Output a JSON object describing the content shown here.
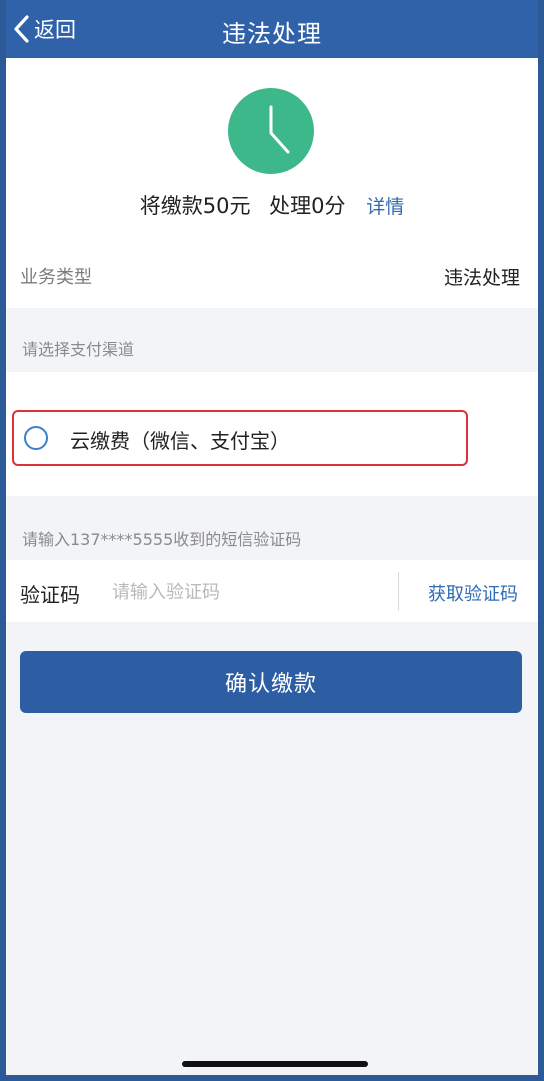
{
  "navbar": {
    "back_label": "返回",
    "title": "违法处理"
  },
  "summary": {
    "amount_text": "将缴款50元",
    "points_text": "处理0分",
    "detail_link": "详情",
    "icon": "clock-icon",
    "icon_color": "#3db88b"
  },
  "business": {
    "label": "业务类型",
    "value": "违法处理"
  },
  "payment": {
    "section_hint": "请选择支付渠道",
    "option_label": "云缴费（微信、支付宝）",
    "selected": false
  },
  "verification": {
    "hint": "请输入137****5555收到的短信验证码",
    "label": "验证码",
    "value": "",
    "placeholder": "请输入验证码",
    "get_code_label": "获取验证码"
  },
  "confirm_label": "确认缴款",
  "colors": {
    "primary": "#2f62a8",
    "link": "#2f6cb5",
    "highlight_border": "#d8333a",
    "background": "#f3f4f8"
  }
}
